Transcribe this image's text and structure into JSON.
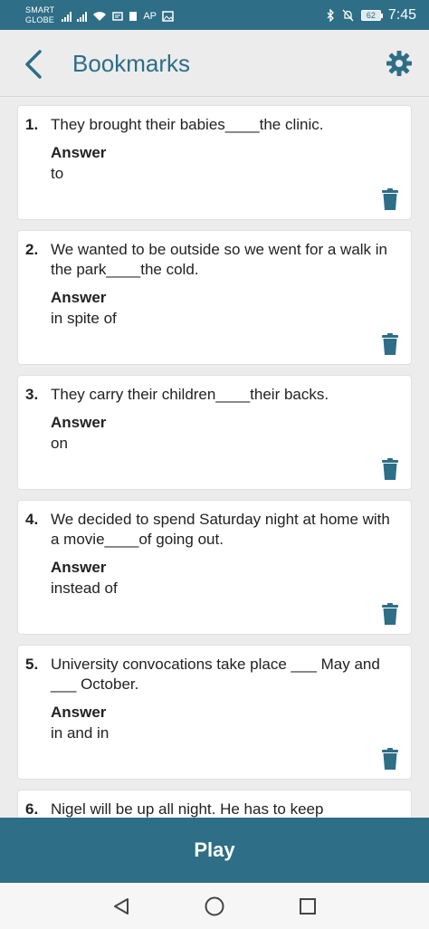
{
  "status": {
    "carrier_line1": "SMART",
    "carrier_line2": "GLOBE",
    "ap_label": "AP",
    "battery": "62",
    "time": "7:45"
  },
  "header": {
    "title": "Bookmarks"
  },
  "bookmarks": [
    {
      "number": "1.",
      "question": "They brought their babies____the clinic.",
      "answer_label": "Answer",
      "answer": "to"
    },
    {
      "number": "2.",
      "question": "We wanted to be outside so we went for a walk in the park____the cold.",
      "answer_label": "Answer",
      "answer": "in spite of"
    },
    {
      "number": "3.",
      "question": "They carry their children____their backs.",
      "answer_label": "Answer",
      "answer": "on"
    },
    {
      "number": "4.",
      "question": "We decided to spend Saturday night at home with a movie____of going out.",
      "answer_label": "Answer",
      "answer": "instead of"
    },
    {
      "number": "5.",
      "question": "University convocations take place ___ May and ___ October.",
      "answer_label": "Answer",
      "answer": "in and in"
    },
    {
      "number": "6.",
      "question": "Nigel will be up all night. He has to keep"
    }
  ],
  "footer": {
    "play_label": "Play"
  },
  "colors": {
    "primary": "#2e6e86",
    "background": "#ececec"
  }
}
